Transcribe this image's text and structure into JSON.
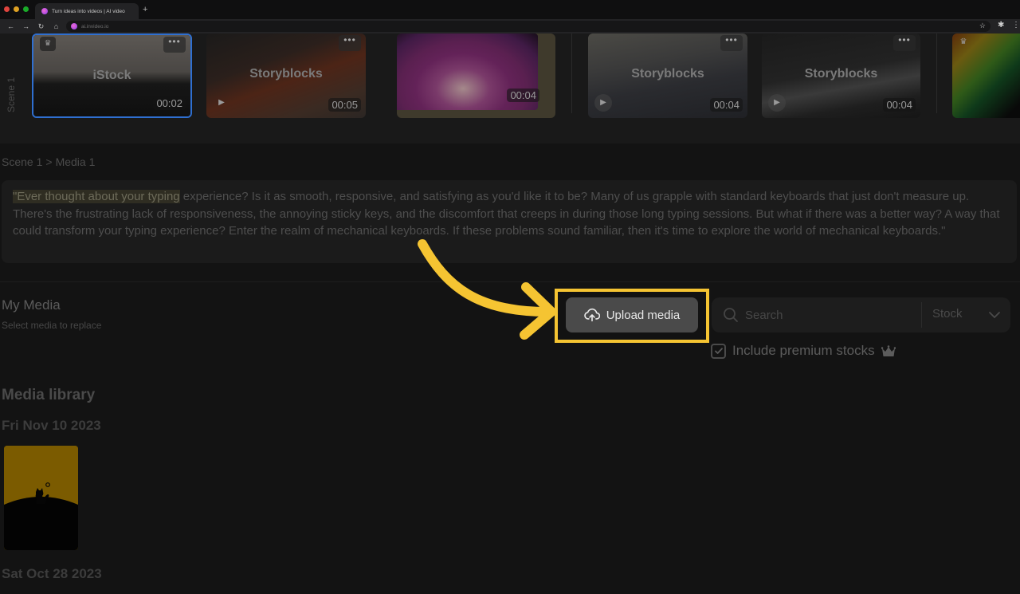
{
  "browser": {
    "tab_title": "Turn ideas into videos | AI video",
    "new_tab": "+",
    "url": "ai.invideo.io",
    "nav": {
      "back": "←",
      "forward": "→",
      "reload": "↻",
      "home": "⌂"
    },
    "star_icon": "☆",
    "extensions_icon": "✱",
    "menu_icon": "⋮",
    "traffic_colors": [
      "#e0443e",
      "#dea123",
      "#1aab29"
    ]
  },
  "scene_strip": {
    "scene_label": "Scene 1",
    "clips": [
      {
        "source": "iStock",
        "duration": "00:02",
        "premium": true,
        "selected": true,
        "playable": false
      },
      {
        "source": "Storyblocks",
        "duration": "00:05",
        "premium": false,
        "selected": false,
        "playable": true
      },
      {
        "source": "",
        "duration": "00:04",
        "premium": false,
        "selected": false,
        "playable": false
      },
      {
        "source": "Storyblocks",
        "duration": "00:04",
        "premium": false,
        "selected": false,
        "playable": true
      },
      {
        "source": "Storyblocks",
        "duration": "00:04",
        "premium": false,
        "selected": false,
        "playable": true
      },
      {
        "source": "iS",
        "duration": "",
        "premium": true,
        "selected": false,
        "playable": false
      }
    ],
    "more_icon": "•••",
    "play_icon": "▶",
    "crown_icon": "♛"
  },
  "breadcrumb": {
    "scene": "Scene 1",
    "separator": ">",
    "media": "Media 1"
  },
  "script": {
    "highlighted": "\"Ever thought about your typing",
    "rest": " experience? Is it as smooth, responsive, and satisfying as you'd like it to be? Many of us grapple with standard keyboards that just don't measure up. There's the frustrating lack of responsiveness, the annoying sticky keys, and the discomfort that creeps in during those long typing sessions. But what if there was a better way? A way that could transform your typing experience? Enter the realm of mechanical keyboards. If these problems sound familiar, then it's time to explore the world of mechanical keyboards.\""
  },
  "my_media": {
    "title": "My Media",
    "subtitle": "Select media to replace",
    "upload_label": "Upload media",
    "search_placeholder": "Search",
    "source_select": "Stock",
    "include_premium_label": "Include premium stocks",
    "include_premium_checked": true
  },
  "library": {
    "title": "Media library",
    "groups": [
      {
        "date": "Fri Nov 10 2023",
        "items": 1
      },
      {
        "date": "Sat Oct 28 2023",
        "items": 0
      }
    ]
  },
  "annotation": {
    "color": "#f5c432"
  }
}
